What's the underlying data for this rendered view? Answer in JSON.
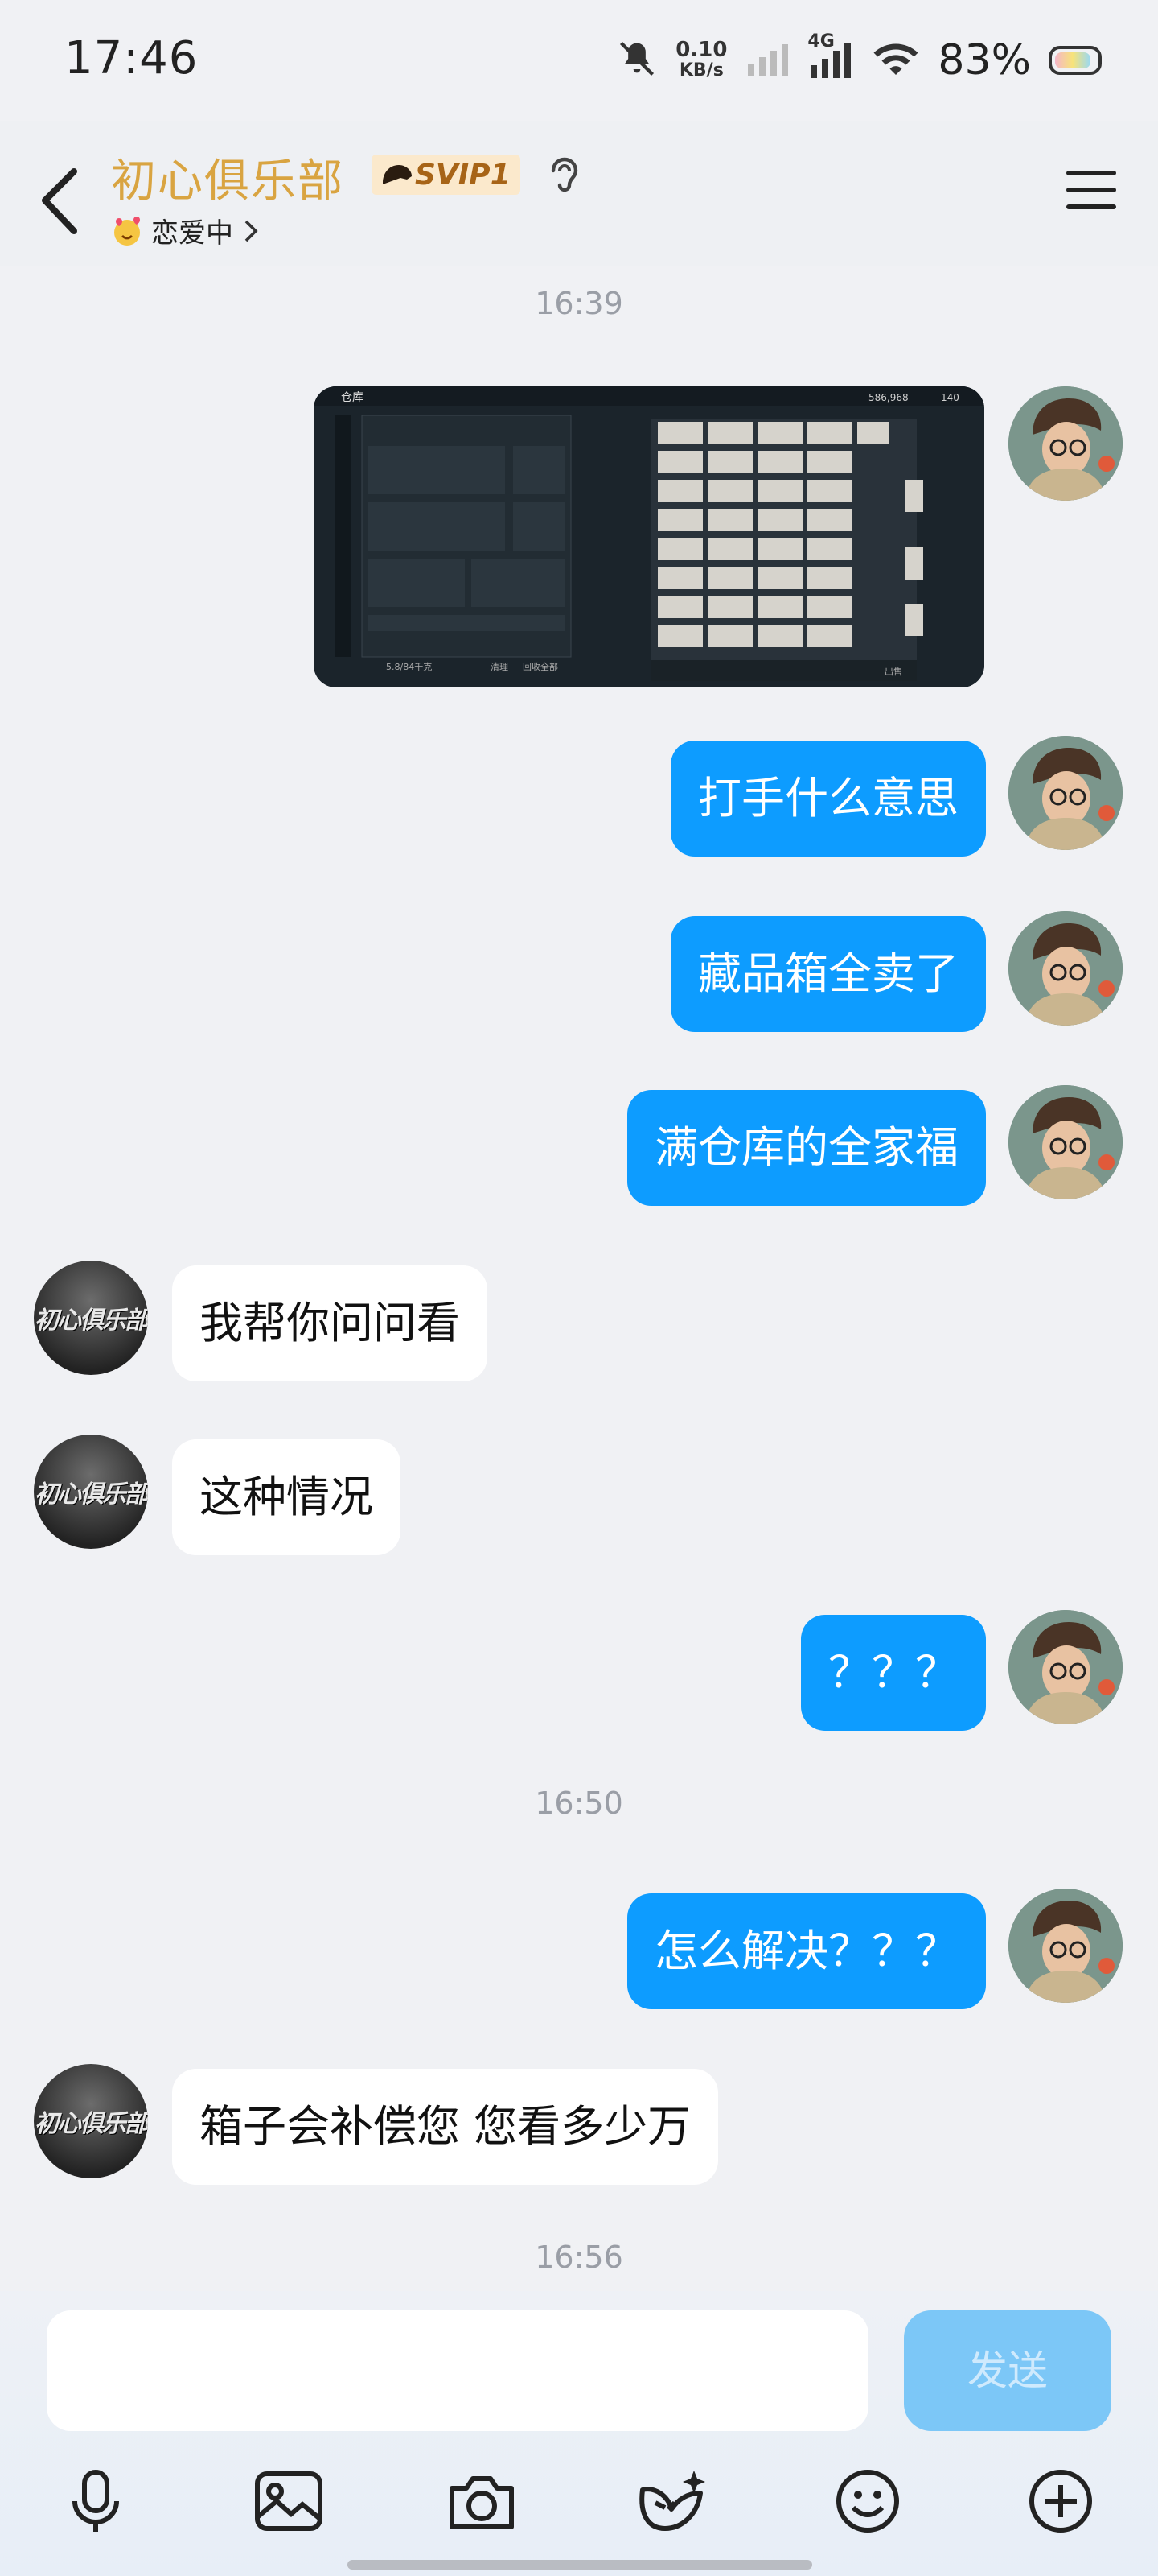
{
  "status_bar": {
    "time": "17:46",
    "net_speed_value": "0.10",
    "net_speed_unit": "KB/s",
    "network_type": "4G",
    "battery_percent": "83%"
  },
  "header": {
    "title": "初心俱乐部",
    "badge": "SVIP1",
    "subtitle": "恋爱中",
    "back_icon": "chevron-left-icon",
    "menu_icon": "hamburger-icon",
    "ear_icon": "ear-icon"
  },
  "chat": {
    "timestamps": [
      "16:39",
      "16:50",
      "16:56"
    ],
    "messages": [
      {
        "side": "out",
        "type": "image",
        "caption": "仓库"
      },
      {
        "side": "out",
        "text": "打手什么意思"
      },
      {
        "side": "out",
        "text": "藏品箱全卖了"
      },
      {
        "side": "out",
        "text": "满仓库的全家福"
      },
      {
        "side": "in",
        "text": "我帮你问问看"
      },
      {
        "side": "in",
        "text": "这种情况"
      },
      {
        "side": "out",
        "text": "？？？"
      },
      {
        "side": "out",
        "text": "怎么解决？？？"
      },
      {
        "side": "in",
        "text": "箱子会补偿您 您看多少万"
      }
    ],
    "club_logo_text": "初心俱乐部",
    "screenshot_labels": {
      "title": "仓库",
      "currency": "586,968",
      "count": "140",
      "bottom_left": "5.8/84千克",
      "btn1": "清理",
      "btn2": "回收全部",
      "btn3": "出售"
    }
  },
  "input": {
    "send_label": "发送"
  },
  "toolbar": [
    "mic-icon",
    "image-icon",
    "camera-icon",
    "sticker-icon",
    "emoji-icon",
    "plus-icon"
  ],
  "colors": {
    "accent": "#0d9cff",
    "title_gold": "#d9a441",
    "send_disabled": "#7cc7f7"
  }
}
